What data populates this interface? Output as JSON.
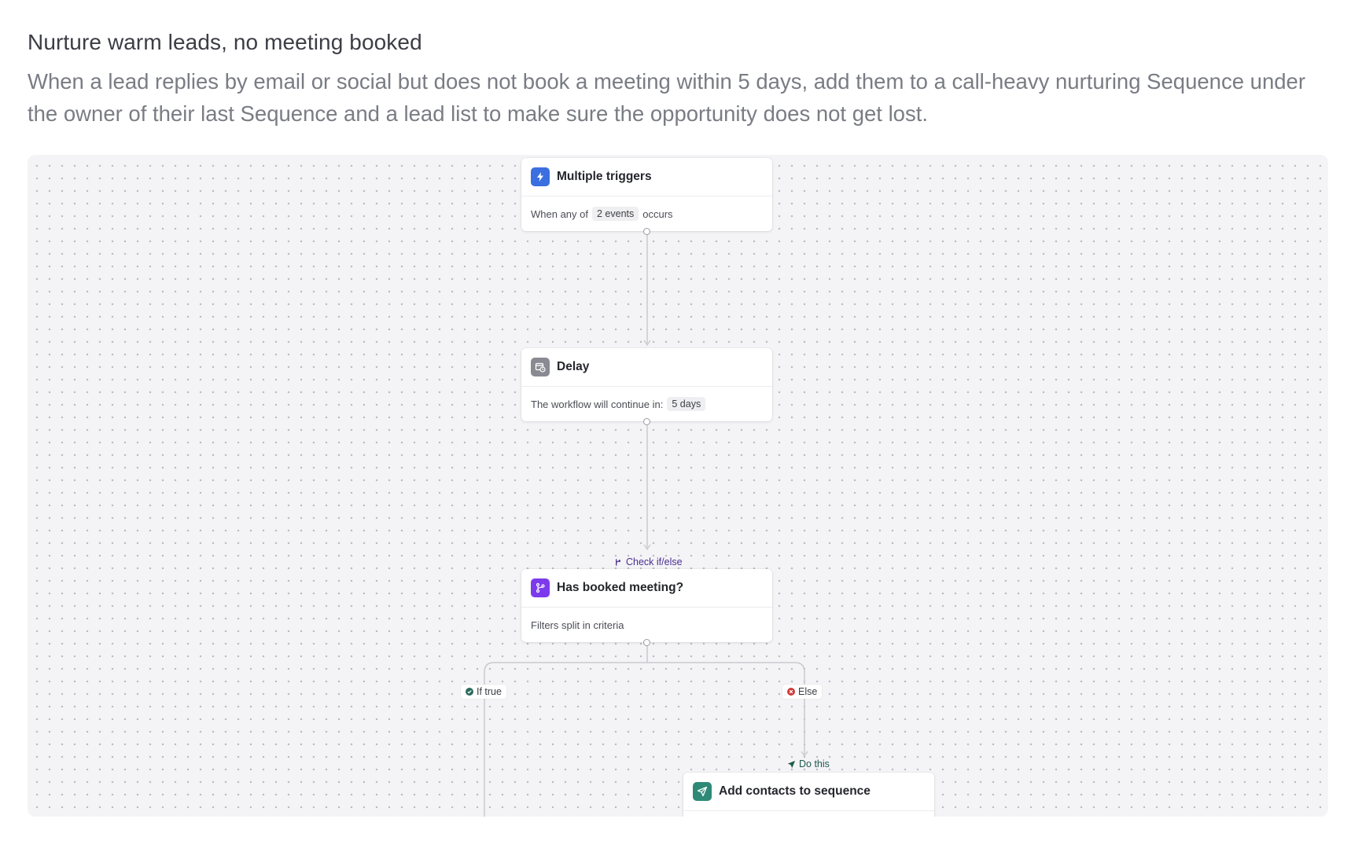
{
  "page": {
    "title": "Nurture warm leads, no meeting booked",
    "description": "When a lead replies by email or social but does not book a meeting within 5 days, add them to a call-heavy nurturing Sequence under the owner of their last Sequence and a lead list to make sure the opportunity does not get lost."
  },
  "nodes": {
    "trigger": {
      "icon": "lightning-icon",
      "title": "Multiple triggers",
      "body_prefix": "When any of",
      "pill": "2 events",
      "body_suffix": "occurs",
      "color": "#3b6fe0"
    },
    "delay": {
      "icon": "calendar-clock-icon",
      "title": "Delay",
      "body_prefix": "The workflow will continue in:",
      "pill": "5 days",
      "color": "#8a8a92"
    },
    "condition": {
      "step_label": "Check if/else",
      "icon": "branch-icon",
      "title": "Has booked meeting?",
      "body": "Filters split in criteria",
      "color": "#7c3aed"
    },
    "action": {
      "step_label": "Do this",
      "icon": "send-icon",
      "title": "Add contacts to sequence",
      "color": "#2e8a77"
    }
  },
  "branches": {
    "if_true": {
      "label": "If true",
      "color": "#2b6b5c"
    },
    "else": {
      "label": "Else",
      "color": "#d03a3a"
    }
  }
}
